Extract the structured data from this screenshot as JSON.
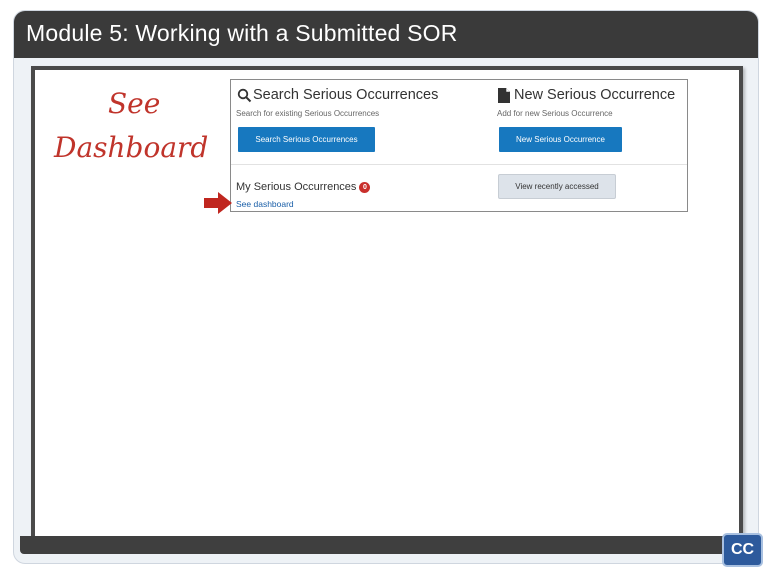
{
  "slide": {
    "title": "Module 5:  Working with a Submitted SOR"
  },
  "annotation": {
    "line1": "See",
    "line2": "Dashboard",
    "color": "#c0342b"
  },
  "panel": {
    "search": {
      "icon": "search-icon",
      "title": "Search Serious Occurrences",
      "subtitle": "Search for existing Serious Occurrences",
      "button_label": "Search Serious Occurrences"
    },
    "new": {
      "icon": "document-icon",
      "title": "New Serious Occurrence",
      "subtitle": "Add for new Serious Occurrence",
      "button_label": "New Serious Occurrence"
    },
    "my": {
      "title": "My Serious Occurrences",
      "badge": "0",
      "link_label": "See dashboard"
    },
    "recent": {
      "button_label": "View recently accessed"
    }
  },
  "cc": {
    "label": "CC"
  },
  "colors": {
    "title_bar": "#3a3a3a",
    "primary_button": "#1778bf",
    "accent_red": "#c9302c"
  }
}
